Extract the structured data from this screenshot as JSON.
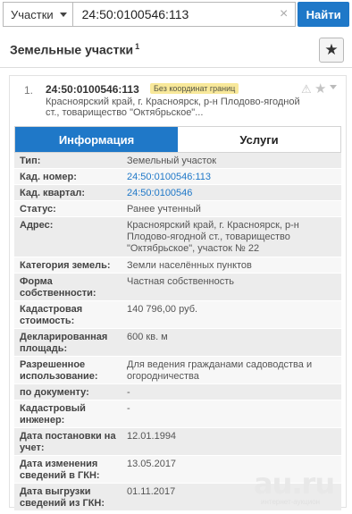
{
  "search": {
    "type_label": "Участки",
    "value": "24:50:0100546:113",
    "clear_glyph": "×",
    "button_label": "Найти"
  },
  "header": {
    "title": "Земельные участки",
    "sup": "1",
    "favorite_glyph": "★"
  },
  "result": {
    "number": "1.",
    "cad_number": "24:50:0100546:113",
    "badge": "Без координат границ",
    "warning_glyph": "⚠",
    "star_glyph": "★",
    "address": "Красноярский край, г. Красноярск, р-н Плодово-ягодной ст., товарищество \"Октябрьское\"..."
  },
  "tabs": [
    {
      "label": "Информация",
      "active": true
    },
    {
      "label": "Услуги",
      "active": false
    }
  ],
  "rows": [
    {
      "key": "Тип:",
      "value": "Земельный участок",
      "link": false
    },
    {
      "key": "Кад. номер:",
      "value": "24:50:0100546:113",
      "link": true
    },
    {
      "key": "Кад. квартал:",
      "value": "24:50:0100546",
      "link": true
    },
    {
      "key": "Статус:",
      "value": "Ранее учтенный",
      "link": false
    },
    {
      "key": "Адрес:",
      "value": "Красноярский край, г. Красноярск, р-н Плодово-ягодной ст., товарищество \"Октябрьское\", участок № 22",
      "link": false
    },
    {
      "key": "Категория земель:",
      "value": "Земли населённых пунктов",
      "link": false
    },
    {
      "key": "Форма собственности:",
      "value": "Частная собственность",
      "link": false
    },
    {
      "key": "Кадастровая стоимость:",
      "value": "140 796,00 руб.",
      "link": false
    },
    {
      "key": "Декларированная площадь:",
      "value": "600 кв. м",
      "link": false
    },
    {
      "key": "Разрешенное использование:",
      "value": "Для ведения гражданами садоводства и огородничества",
      "link": false
    },
    {
      "key": "по документу:",
      "value": "-",
      "link": false
    },
    {
      "key": "Кадастровый инженер:",
      "value": "-",
      "link": false
    },
    {
      "key": "Дата постановки на учет:",
      "value": "12.01.1994",
      "link": false
    },
    {
      "key": "Дата изменения сведений в ГКН:",
      "value": "13.05.2017",
      "link": false
    },
    {
      "key": "Дата выгрузки сведений из ГКН:",
      "value": "01.11.2017",
      "link": false
    }
  ],
  "watermark": {
    "main": "au.ru",
    "sub": "интернет-аукцион"
  },
  "colors": {
    "accent": "#1f78c8",
    "badge_bg": "#f8e89a",
    "row_odd": "#ececec",
    "row_even": "#f7f7f7"
  }
}
